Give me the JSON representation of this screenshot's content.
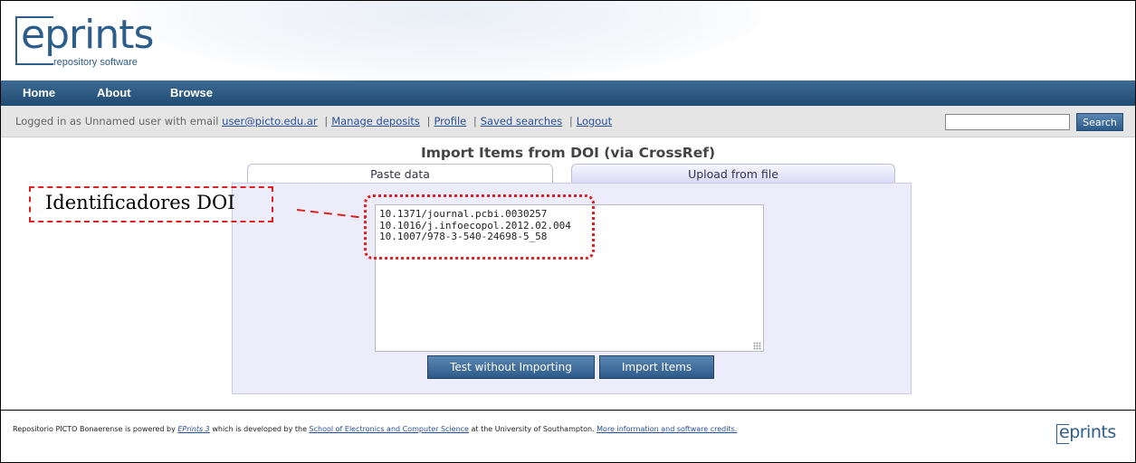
{
  "header": {
    "logo_text": "eprints",
    "logo_subtitle": "repository software"
  },
  "nav": {
    "items": [
      "Home",
      "About",
      "Browse"
    ]
  },
  "login_bar": {
    "prefix": "Logged in as Unnamed user with email",
    "email": "user@picto.edu.ar",
    "links": [
      "Manage deposits",
      "Profile",
      "Saved searches",
      "Logout"
    ],
    "search_value": "",
    "search_button": "Search"
  },
  "main": {
    "title": "Import Items from DOI (via CrossRef)",
    "tabs": [
      {
        "label": "Paste data",
        "active": true
      },
      {
        "label": "Upload from file",
        "active": false
      }
    ],
    "textarea_value": "10.1371/journal.pcbi.0030257\n10.1016/j.infoecopol.2012.02.004\n10.1007/978-3-540-24698-5_58",
    "buttons": {
      "test": "Test without Importing",
      "import": "Import Items"
    }
  },
  "annotation": {
    "label": "Identificadores DOI",
    "color": "#e02020"
  },
  "footer": {
    "part1": "Repositorio PICTO Bonaerense is powered by",
    "eprints_link": "EPrints 3",
    "part2": "which is developed by the",
    "school_link": "School of Electronics and Computer Science",
    "part3": "at the University of Southampton.",
    "credits_link": "More information and software credits.",
    "logo_text": "eprints"
  },
  "colors": {
    "brand_blue": "#2d5d8a",
    "nav_bg": "#1f4b73",
    "panel_bg": "#ececfb",
    "link": "#2a4f9c"
  }
}
